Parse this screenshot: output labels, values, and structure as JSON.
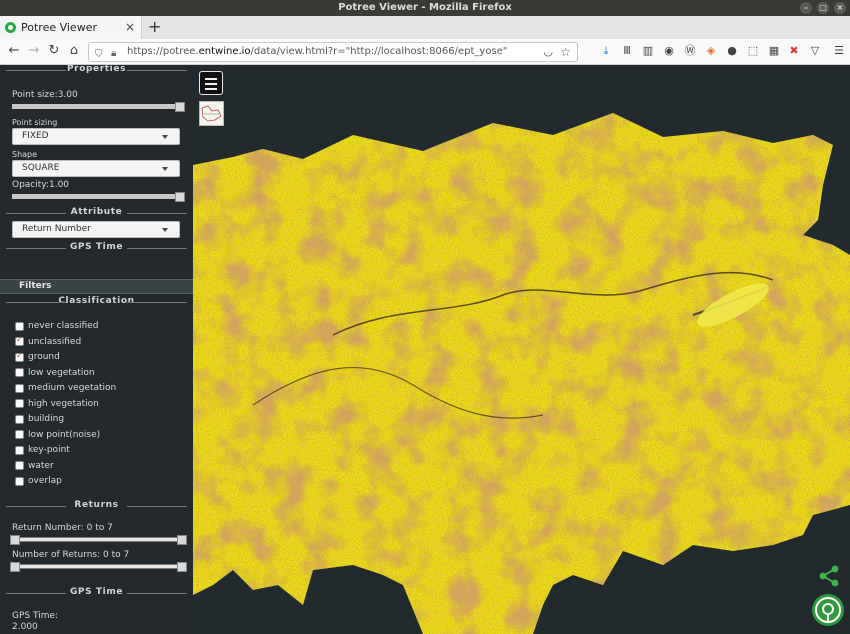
{
  "window": {
    "title": "Potree Viewer - Mozilla Firefox"
  },
  "tabs": [
    {
      "label": "Potree Viewer",
      "close": "×"
    }
  ],
  "new_tab": "+",
  "navbar": {
    "url_prefix": "https://potree.",
    "url_host": "entwine.io",
    "url_rest": "/data/view.html?r=\"http://localhost:8066/ept_yose\""
  },
  "sidebar": {
    "properties_title": "Properties",
    "point_size_label": "Point size:3.00",
    "point_size_value": 1.0,
    "point_sizing_label": "Point sizing",
    "point_sizing_value": "FIXED",
    "shape_label": "Shape",
    "shape_value": "SQUARE",
    "opacity_label": "Opacity:1.00",
    "opacity_value": 1.0,
    "attribute_title": "Attribute",
    "attribute_value": "Return Number",
    "gps_time_title": "GPS Time",
    "filters_label": "Filters",
    "classification_title": "Classification",
    "classes": [
      {
        "label": "never classified",
        "checked": false
      },
      {
        "label": "unclassified",
        "checked": true
      },
      {
        "label": "ground",
        "checked": true
      },
      {
        "label": "low vegetation",
        "checked": false
      },
      {
        "label": "medium vegetation",
        "checked": false
      },
      {
        "label": "high vegetation",
        "checked": false
      },
      {
        "label": "building",
        "checked": false
      },
      {
        "label": "low point(noise)",
        "checked": false
      },
      {
        "label": "key-point",
        "checked": false
      },
      {
        "label": "water",
        "checked": false
      },
      {
        "label": "overlap",
        "checked": false
      }
    ],
    "returns_title": "Returns",
    "return_number_label": "Return Number: 0 to 7",
    "number_of_returns_label": "Number of Returns: 0 to 7",
    "gps_time_section_title": "GPS Time",
    "gps_time_label": "GPS Time:",
    "gps_time_value": "2.000"
  },
  "colors": {
    "sidebar_bg": "#23292c",
    "pointcloud_yellow": "#e8e40e",
    "pointcloud_orange": "#c6781a",
    "potree_green": "#2f9a3d"
  }
}
